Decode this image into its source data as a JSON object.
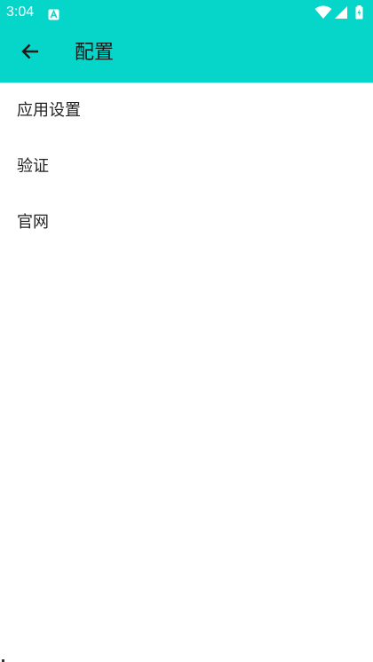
{
  "status_bar": {
    "time": "3:04",
    "app_icon": "notification-a-icon",
    "icons": [
      "wifi-icon",
      "signal-icon",
      "battery-icon"
    ]
  },
  "app_bar": {
    "title": "配置",
    "back_icon": "arrow-back-icon",
    "background_color": "#06d6c9"
  },
  "menu": {
    "items": [
      {
        "label": "应用设置"
      },
      {
        "label": "验证"
      },
      {
        "label": "官网"
      }
    ]
  }
}
